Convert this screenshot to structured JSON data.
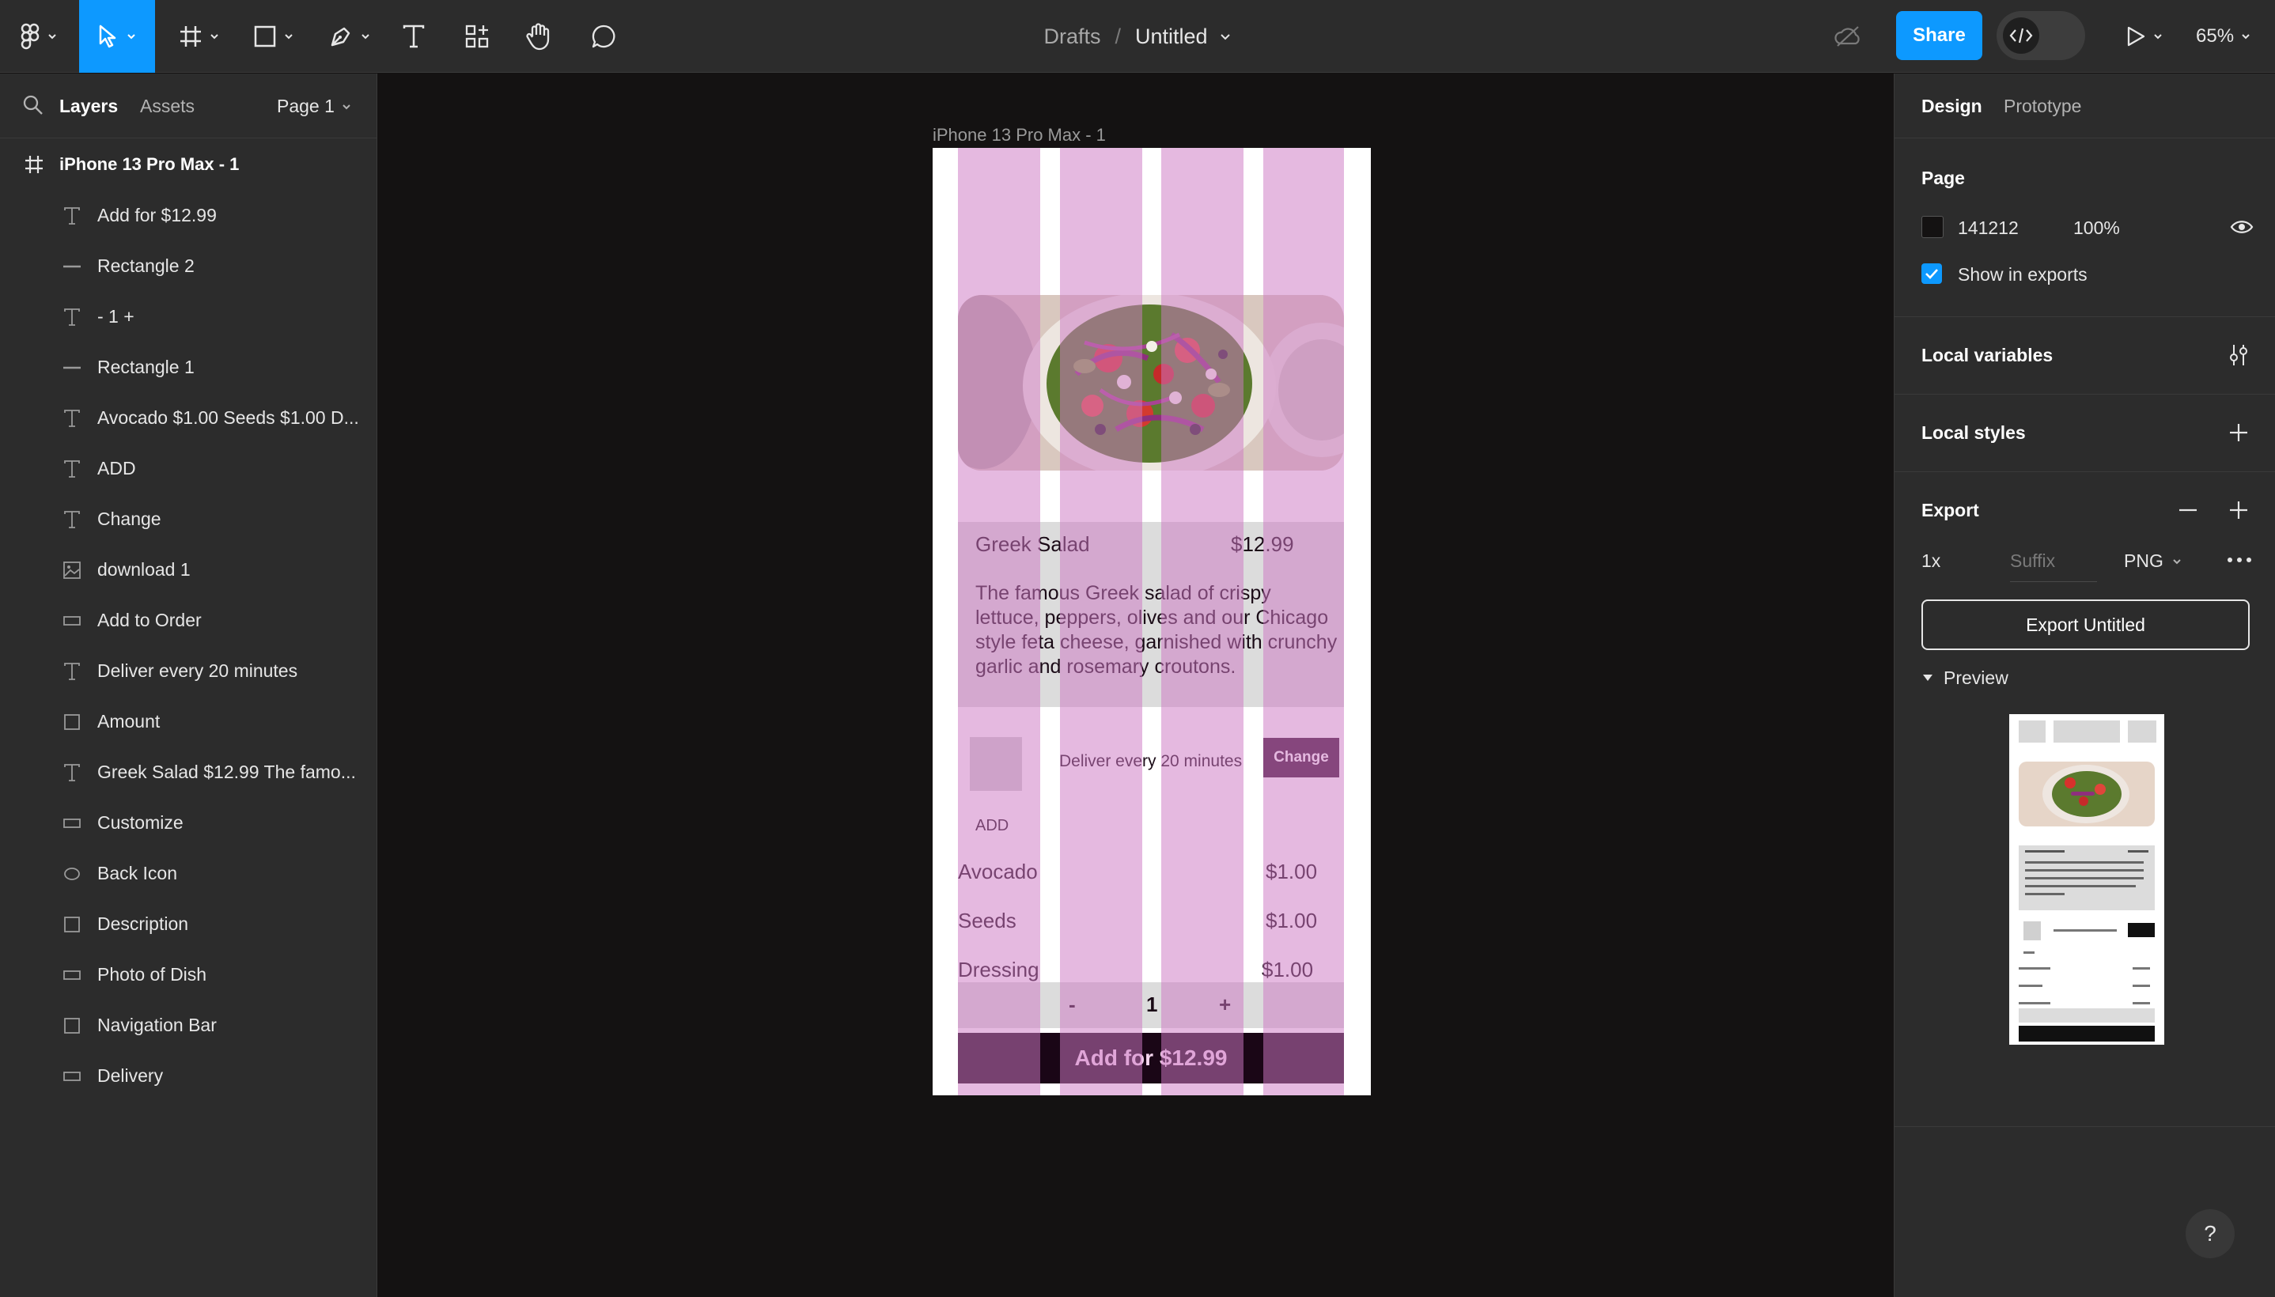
{
  "toolbar": {
    "breadcrumb_drafts": "Drafts",
    "breadcrumb_sep": "/",
    "file_name": "Untitled",
    "share_label": "Share",
    "zoom_label": "65%",
    "accent_color": "#0d99ff"
  },
  "left_panel": {
    "tab_layers": "Layers",
    "tab_assets": "Assets",
    "page_selector": "Page 1",
    "root_layer": "iPhone 13 Pro Max - 1",
    "layers": [
      {
        "icon": "text-icon",
        "label": "Add for $12.99"
      },
      {
        "icon": "line-icon",
        "label": "Rectangle 2"
      },
      {
        "icon": "text-icon",
        "label": "- 1 +"
      },
      {
        "icon": "line-icon",
        "label": "Rectangle 1"
      },
      {
        "icon": "text-icon",
        "label": "Avocado $1.00 Seeds $1.00 D..."
      },
      {
        "icon": "text-icon",
        "label": "ADD"
      },
      {
        "icon": "text-icon",
        "label": "Change"
      },
      {
        "icon": "image-icon",
        "label": "download 1"
      },
      {
        "icon": "rectangle-icon",
        "label": "Add to Order"
      },
      {
        "icon": "text-icon",
        "label": "Deliver every 20 minutes"
      },
      {
        "icon": "square-icon",
        "label": "Amount"
      },
      {
        "icon": "text-icon",
        "label": "Greek Salad $12.99 The famo..."
      },
      {
        "icon": "rectangle-icon",
        "label": "Customize"
      },
      {
        "icon": "ellipse-icon",
        "label": "Back Icon"
      },
      {
        "icon": "square-icon",
        "label": "Description"
      },
      {
        "icon": "rectangle-icon",
        "label": "Photo of Dish"
      },
      {
        "icon": "square-icon",
        "label": "Navigation Bar"
      },
      {
        "icon": "rectangle-icon",
        "label": "Delivery"
      }
    ]
  },
  "frame": {
    "label": "iPhone 13 Pro Max - 1",
    "dish_name": "Greek Salad",
    "dish_price": "$12.99",
    "description": "The famous Greek salad of crispy lettuce, peppers, olives and our Chicago style feta cheese, garnished with crunchy garlic and rosemary croutons.",
    "deliver_text": "Deliver every 20 minutes",
    "change_label": "Change",
    "add_label": "ADD",
    "addons": [
      {
        "name": "Avocado",
        "price": "$1.00"
      },
      {
        "name": "Seeds",
        "price": "$1.00"
      },
      {
        "name": "Dressing",
        "price": "$1.00"
      }
    ],
    "minus": "-",
    "quantity": "1",
    "plus": "+",
    "cta_label": "Add for $12.99"
  },
  "right_panel": {
    "tab_design": "Design",
    "tab_prototype": "Prototype",
    "page_title": "Page",
    "page_color_hex": "141212",
    "page_opacity": "100%",
    "show_in_exports": "Show in exports",
    "local_variables": "Local variables",
    "local_styles": "Local styles",
    "export_title": "Export",
    "export_scale": "1x",
    "export_suffix_placeholder": "Suffix",
    "export_format": "PNG",
    "export_button": "Export Untitled",
    "preview_label": "Preview"
  },
  "help": "?"
}
